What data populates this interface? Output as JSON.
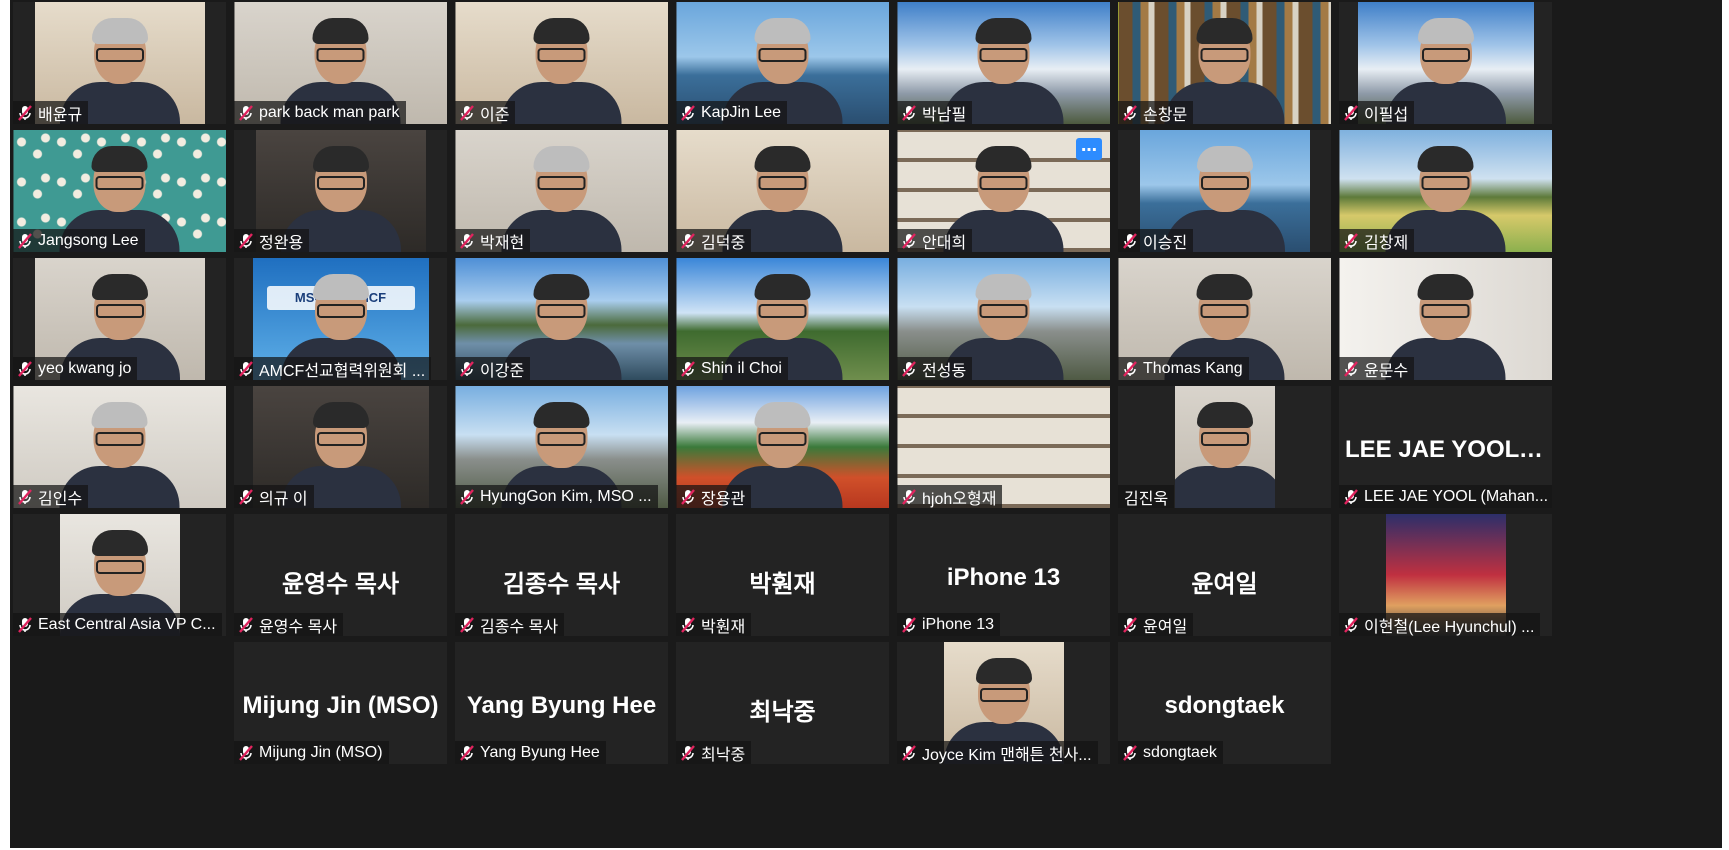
{
  "tiles": [
    {
      "name": "배윤규",
      "bg": "wall-warm",
      "w": 170
    },
    {
      "name": "park back man park",
      "bg": "wall-light",
      "w": 236
    },
    {
      "name": "이준",
      "bg": "wall-warm",
      "w": 236
    },
    {
      "name": "KapJin Lee",
      "bg": "sky-sea",
      "w": 236
    },
    {
      "name": "박남필",
      "bg": "sky-mount",
      "w": 236
    },
    {
      "name": "손창문",
      "bg": "books",
      "w": 236,
      "active": true
    },
    {
      "name": "이필섭",
      "bg": "sky-mount",
      "w": 176
    },
    {
      "name": "Jangsong Lee",
      "bg": "blossom",
      "w": 236
    },
    {
      "name": "정완용",
      "bg": "wall-dark",
      "w": 170
    },
    {
      "name": "박재현",
      "bg": "wall-light",
      "w": 236
    },
    {
      "name": "김덕중",
      "bg": "wall-warm",
      "w": 236
    },
    {
      "name": "안대희",
      "bg": "shelves",
      "w": 236,
      "more": true
    },
    {
      "name": "이승진",
      "bg": "sky-sea",
      "w": 170
    },
    {
      "name": "김창제",
      "bg": "tulips",
      "w": 236
    },
    {
      "name": "yeo kwang jo",
      "bg": "wall-light",
      "w": 170
    },
    {
      "name": "AMCF선교협력위원회 ...",
      "bg": "amcf",
      "w": 176,
      "logo": "MSO for AMCF"
    },
    {
      "name": "이강준",
      "bg": "lake",
      "w": 236
    },
    {
      "name": "Shin il Choi",
      "bg": "clouds",
      "w": 236
    },
    {
      "name": "전성동",
      "bg": "town",
      "w": 236
    },
    {
      "name": "Thomas Kang",
      "bg": "wall-light",
      "w": 236
    },
    {
      "name": "윤문수",
      "bg": "white-wall",
      "w": 236
    },
    {
      "name": "김인수",
      "bg": "office",
      "w": 236
    },
    {
      "name": "의규 이",
      "bg": "wall-dark",
      "w": 176
    },
    {
      "name": "HyungGon Kim, MSO ...",
      "bg": "town",
      "w": 236
    },
    {
      "name": "장용관",
      "bg": "poppies",
      "w": 236
    },
    {
      "name": "hjoh오형재",
      "bg": "shelves",
      "w": 236,
      "noperson": true
    },
    {
      "name": "김진욱",
      "bg": "wall-light",
      "w": 100,
      "nomic": true
    },
    {
      "name": "LEE JAE YOOL (Mahan...",
      "big": "LEE JAE YOOL (..."
    },
    {
      "name": "East Central Asia VP C...",
      "bg": "office",
      "w": 120
    },
    {
      "name": "윤영수 목사",
      "big": "윤영수 목사"
    },
    {
      "name": "김종수 목사",
      "big": "김종수 목사"
    },
    {
      "name": "박훤재",
      "big": "박훤재"
    },
    {
      "name": "iPhone 13",
      "big": "iPhone 13"
    },
    {
      "name": "윤여일",
      "big": "윤여일"
    },
    {
      "name": "이현철(Lee Hyunchul) ...",
      "bg": "church",
      "w": 120,
      "noperson": true
    },
    {
      "name": "Mijung Jin (MSO)",
      "big": "Mijung Jin (MSO)"
    },
    {
      "name": "Yang Byung Hee",
      "big": "Yang Byung Hee"
    },
    {
      "name": "최낙중",
      "big": "최낙중"
    },
    {
      "name": "Joyce Kim 맨해튼 천사...",
      "bg": "wall-warm",
      "w": 120
    },
    {
      "name": "sdongtaek",
      "big": "sdongtaek"
    }
  ],
  "colors": {
    "active_outline": "#c6e53a",
    "mic_muted": "#e0245e",
    "more_button": "#2d8cff"
  }
}
